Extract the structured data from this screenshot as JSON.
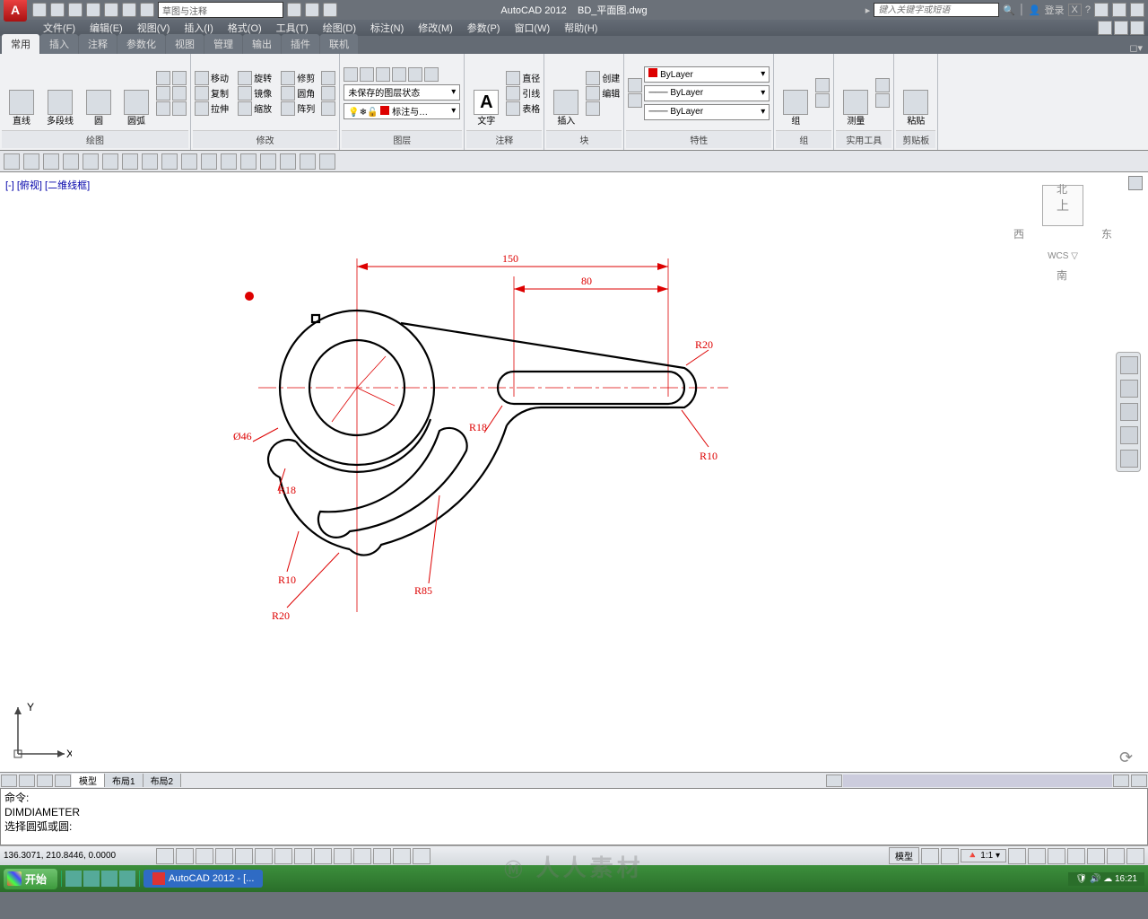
{
  "title": {
    "app": "AutoCAD 2012",
    "file": "BD_平面图.dwg",
    "search_placeholder": "键入关键字或短语",
    "user": "登录"
  },
  "menu": [
    "文件(F)",
    "编辑(E)",
    "视图(V)",
    "插入(I)",
    "格式(O)",
    "工具(T)",
    "绘图(D)",
    "标注(N)",
    "修改(M)",
    "参数(P)",
    "窗口(W)",
    "帮助(H)"
  ],
  "qat_workspace": "草图与注释",
  "tabs": [
    "常用",
    "插入",
    "注释",
    "参数化",
    "视图",
    "管理",
    "输出",
    "插件",
    "联机"
  ],
  "ribbon": {
    "draw": {
      "title": "绘图",
      "btns": [
        "直线",
        "多段线",
        "圆",
        "圆弧"
      ]
    },
    "modify": {
      "title": "修改",
      "items": [
        [
          "移动",
          "旋转",
          "修剪"
        ],
        [
          "复制",
          "镜像",
          "圆角"
        ],
        [
          "拉伸",
          "缩放",
          "阵列"
        ]
      ]
    },
    "layer": {
      "title": "图层",
      "state": "未保存的图层状态",
      "current_layer": "标注与…"
    },
    "annot": {
      "title": "注释",
      "text": "文字",
      "items": [
        "直径",
        "引线",
        "表格"
      ]
    },
    "block": {
      "title": "块",
      "btn": "插入",
      "items": [
        "创建",
        "编辑"
      ]
    },
    "props": {
      "title": "特性",
      "bycolor": "ByLayer",
      "byline": "ByLayer",
      "bylw": "ByLayer"
    },
    "group": {
      "title": "组",
      "btn": "组"
    },
    "util": {
      "title": "实用工具",
      "btn": "测量"
    },
    "clip": {
      "title": "剪贴板",
      "btn": "粘贴"
    }
  },
  "viewport": {
    "minus": "[-]",
    "view": "[俯视]",
    "style": "[二维线框]"
  },
  "viewcube": {
    "n": "北",
    "s": "南",
    "e": "东",
    "w": "西",
    "top": "上",
    "wcs": "WCS ▽"
  },
  "dims": {
    "d150": "150",
    "d80": "80",
    "r20": "R20",
    "r10": "R10",
    "r18": "R18",
    "r85": "R85",
    "dia46": "Ø46",
    "r20b": "R20",
    "r10b": "R10",
    "r18b": "R18"
  },
  "ucs": {
    "x": "X",
    "y": "Y"
  },
  "layouts": {
    "model": "模型",
    "l1": "布局1",
    "l2": "布局2"
  },
  "cmd": {
    "l1": "命令:",
    "l2": "DIMDIAMETER",
    "l3": "选择圆弧或圆:"
  },
  "status": {
    "coords": "136.3071, 210.8446, 0.0000",
    "model": "模型",
    "scale": "1:1"
  },
  "taskbar": {
    "start": "开始",
    "app": "AutoCAD 2012 - [...",
    "time": "16:21"
  },
  "watermark": "人人素材"
}
